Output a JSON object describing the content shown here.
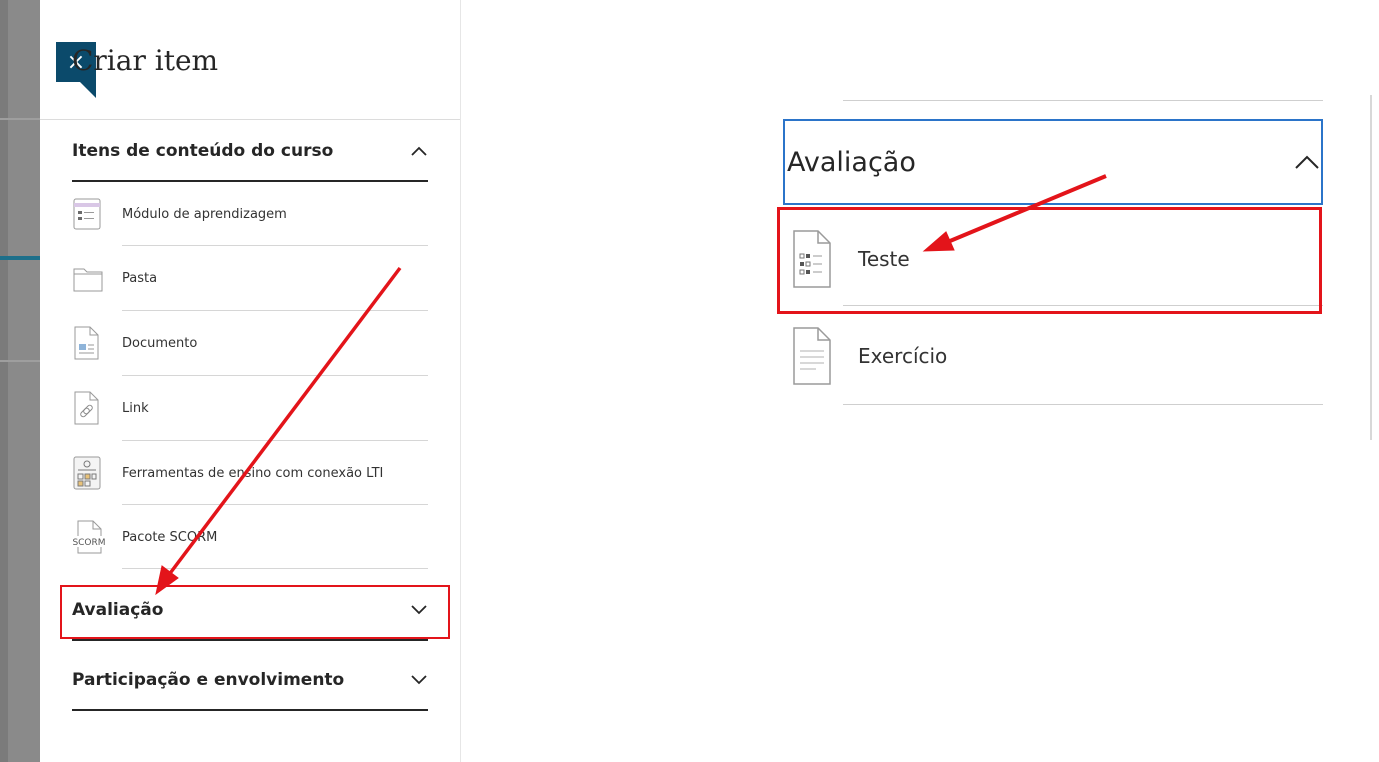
{
  "panel": {
    "close_symbol": "×",
    "title": "Criar item"
  },
  "sections": {
    "course_content": {
      "label": "Itens de conteúdo do curso",
      "state": "expanded"
    },
    "assessment": {
      "label": "Avaliação",
      "state": "collapsed"
    },
    "participation": {
      "label": "Participação e envolvimento",
      "state": "collapsed"
    }
  },
  "course_items": [
    {
      "label": "Módulo de aprendizagem",
      "icon": "learning-module-icon"
    },
    {
      "label": "Pasta",
      "icon": "folder-icon"
    },
    {
      "label": "Documento",
      "icon": "document-icon"
    },
    {
      "label": "Link",
      "icon": "link-icon"
    },
    {
      "label": "Ferramentas de ensino com conexão LTI",
      "icon": "lti-tools-icon"
    },
    {
      "label": "Pacote SCORM",
      "icon": "scorm-package-icon",
      "icon_text": "SCORM"
    }
  ],
  "zoom": {
    "header_label": "Avaliação",
    "items": [
      {
        "label": "Teste",
        "icon": "test-icon"
      },
      {
        "label": "Exercício",
        "icon": "assignment-icon"
      }
    ]
  },
  "annotations": {
    "highlight_color": "#e3141a",
    "focus_color": "#2b74c9"
  }
}
